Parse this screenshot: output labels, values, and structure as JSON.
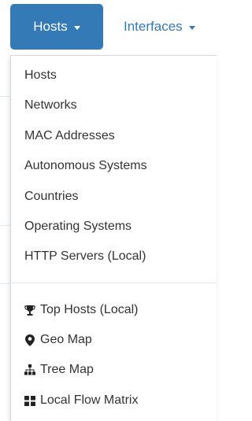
{
  "navbar": {
    "hosts_button_label": "Hosts",
    "interfaces_label": "Interfaces"
  },
  "dropdown": {
    "items": [
      {
        "label": "Hosts",
        "icon": null
      },
      {
        "label": "Networks",
        "icon": null
      },
      {
        "label": "MAC Addresses",
        "icon": null
      },
      {
        "label": "Autonomous Systems",
        "icon": null
      },
      {
        "label": "Countries",
        "icon": null
      },
      {
        "label": "Operating Systems",
        "icon": null
      },
      {
        "label": "HTTP Servers (Local)",
        "icon": null
      }
    ],
    "extra_items": [
      {
        "label": "Top Hosts (Local)",
        "icon": "trophy-icon"
      },
      {
        "label": "Geo Map",
        "icon": "map-marker-icon"
      },
      {
        "label": "Tree Map",
        "icon": "sitemap-icon"
      },
      {
        "label": "Local Flow Matrix",
        "icon": "th-large-icon"
      }
    ]
  },
  "colors": {
    "accent": "#337ab7",
    "text": "#333333",
    "divider": "#e5e5e5"
  }
}
